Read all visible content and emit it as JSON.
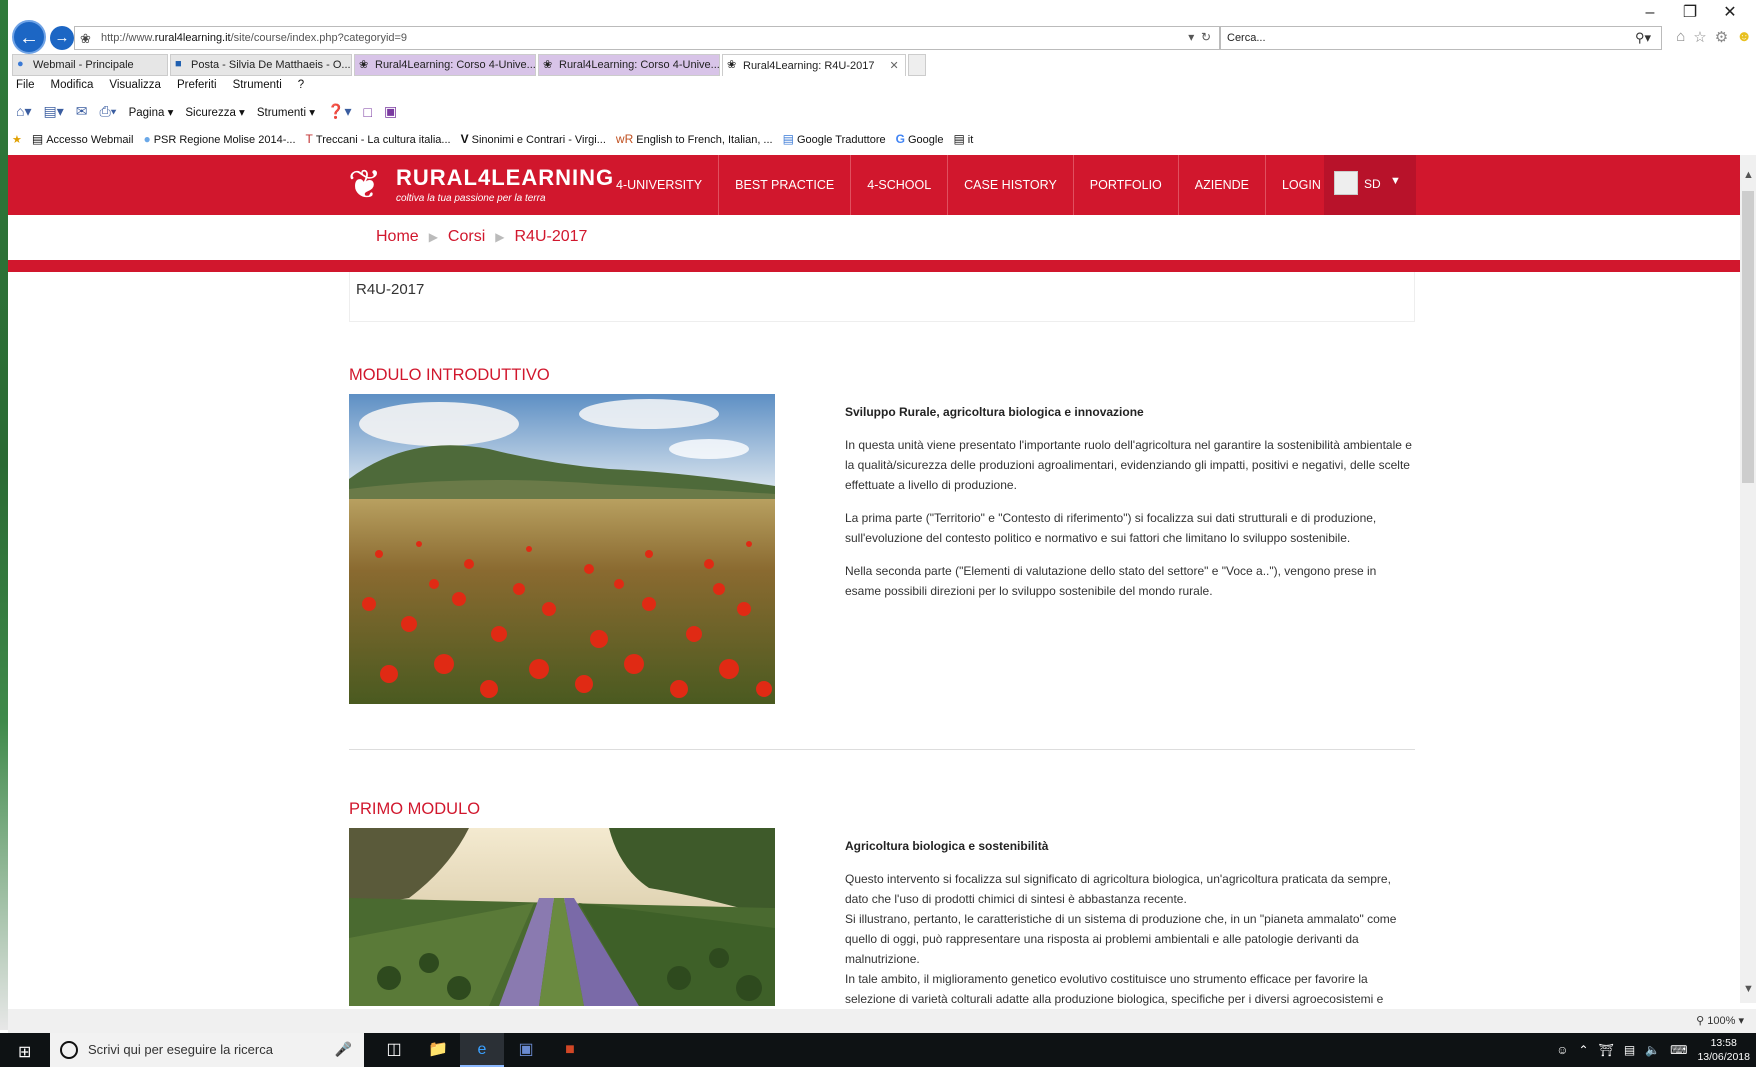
{
  "browser": {
    "url_prefix": "http://www.",
    "url_host": "rural4learning.it",
    "url_path": "/site/course/index.php?categoryid=9",
    "search_placeholder": "Cerca...",
    "tabs": [
      {
        "label": "Webmail - Principale"
      },
      {
        "label": "Posta - Silvia De Matthaeis - O..."
      },
      {
        "label": "Rural4Learning: Corso 4-Unive..."
      },
      {
        "label": "Rural4Learning: Corso 4-Unive..."
      },
      {
        "label": "Rural4Learning: R4U-2017"
      }
    ],
    "menu": [
      "File",
      "Modifica",
      "Visualizza",
      "Preferiti",
      "Strumenti",
      "?"
    ],
    "commands": [
      "Pagina",
      "Sicurezza",
      "Strumenti"
    ],
    "favorites": [
      "Accesso Webmail",
      "PSR Regione Molise 2014-...",
      "Treccani - La cultura italia...",
      "Sinonimi e Contrari - Virgi...",
      "English to French, Italian, ...",
      "Google Traduttore",
      "Google",
      "it"
    ],
    "zoom": "100%"
  },
  "site": {
    "logo_brand": "RURAL4LEARNING",
    "logo_tagline": "coltiva la tua passione per la terra",
    "nav": [
      "4-UNIVERSITY",
      "BEST PRACTICE",
      "4-SCHOOL",
      "CASE HISTORY",
      "PORTFOLIO",
      "AZIENDE",
      "LOGIN"
    ],
    "user_initials": "SD",
    "breadcrumb": [
      "Home",
      "Corsi",
      "R4U-2017"
    ],
    "course_title": "R4U-2017"
  },
  "modules": [
    {
      "title": "MODULO INTRODUTTIVO",
      "heading": "Sviluppo Rurale, agricoltura biologica e innovazione",
      "paragraphs": [
        "In questa unità viene presentato l'importante ruolo dell'agricoltura nel garantire la sostenibilità ambientale e la qualità/sicurezza delle produzioni agroalimentari, evidenziando gli impatti, positivi e negativi, delle scelte effettuate a livello di produzione.",
        "La prima parte (\"Territorio\" e \"Contesto di riferimento\") si focalizza sui dati strutturali e di produzione, sull'evoluzione del contesto politico e normativo e sui fattori che limitano lo sviluppo sostenibile.",
        "Nella seconda parte (\"Elementi di valutazione dello stato del settore\" e \"Voce a..\"), vengono prese in esame possibili direzioni per lo sviluppo sostenibile del mondo rurale."
      ]
    },
    {
      "title": "PRIMO MODULO",
      "heading": "Agricoltura biologica e sostenibilità",
      "paragraphs": [
        "Questo intervento si focalizza sul significato di agricoltura biologica, un'agricoltura praticata da sempre, dato che l'uso di prodotti chimici di sintesi è abbastanza recente.",
        "Si illustrano, pertanto, le caratteristiche di un sistema di produzione che, in un \"pianeta ammalato\" come quello di oggi, può rappresentare una risposta ai problemi ambientali e alle patologie derivanti da malnutrizione.",
        "In tale ambito, il miglioramento genetico evolutivo costituisce uno strumento efficace per favorire la selezione di varietà colturali adatte alla produzione biologica, specifiche per i diversi agroecosistemi e"
      ]
    }
  ],
  "taskbar": {
    "search_placeholder": "Scrivi qui per eseguire la ricerca",
    "time": "13:58",
    "date": "13/06/2018"
  },
  "colors": {
    "brand_red": "#d1172d"
  }
}
